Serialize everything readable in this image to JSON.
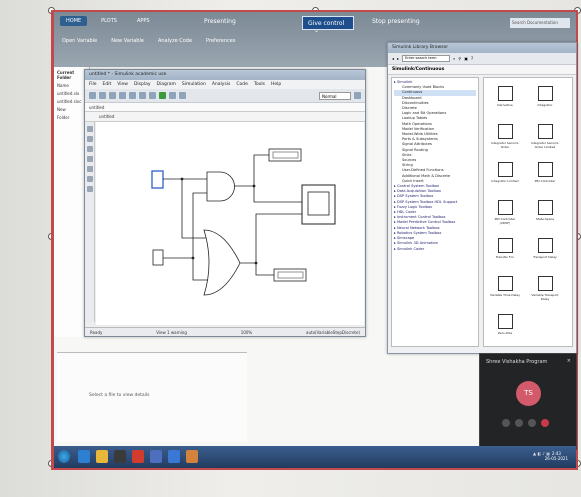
{
  "presentation_bar": {
    "tab_home": "HOME",
    "tab_plots": "PLOTS",
    "tab_apps": "APPS",
    "presenting": "Presenting",
    "give_control": "Give control",
    "stop_presenting": "Stop presenting",
    "search_placeholder": "Search Documentation"
  },
  "matlab_toolbar": {
    "open_variable": "Open Variable",
    "new_variable": "New Variable",
    "analyze_code": "Analyze Code",
    "preferences": "Preferences"
  },
  "left_tree": {
    "header": "Current Folder",
    "items": [
      "Name",
      "untitled.slx",
      "untitled.slxc",
      "New",
      "Folder"
    ]
  },
  "model_window": {
    "title": "untitled * - Simulink academic use",
    "menu": [
      "File",
      "Edit",
      "View",
      "Display",
      "Diagram",
      "Simulation",
      "Analysis",
      "Code",
      "Tools",
      "Help"
    ],
    "sim_mode": "Normal",
    "breadcrumb": "untitled",
    "breadcrumb2": "untitled",
    "status_ready": "Ready",
    "status_warning": "View 1 warning",
    "status_zoom": "100%",
    "status_solver": "auto(VariableStepDiscrete)"
  },
  "library_browser": {
    "title": "Simulink Library Browser",
    "search_placeholder": "Enter search term",
    "heading": "Simulink/Continuous",
    "tree": [
      {
        "label": "Simulink",
        "indent": 0
      },
      {
        "label": "Commonly Used Blocks",
        "indent": 1
      },
      {
        "label": "Continuous",
        "indent": 1
      },
      {
        "label": "Dashboard",
        "indent": 1
      },
      {
        "label": "Discontinuities",
        "indent": 1
      },
      {
        "label": "Discrete",
        "indent": 1
      },
      {
        "label": "Logic and Bit Operations",
        "indent": 1
      },
      {
        "label": "Lookup Tables",
        "indent": 1
      },
      {
        "label": "Math Operations",
        "indent": 1
      },
      {
        "label": "Model Verification",
        "indent": 1
      },
      {
        "label": "Model-Wide Utilities",
        "indent": 1
      },
      {
        "label": "Ports & Subsystems",
        "indent": 1
      },
      {
        "label": "Signal Attributes",
        "indent": 1
      },
      {
        "label": "Signal Routing",
        "indent": 1
      },
      {
        "label": "Sinks",
        "indent": 1
      },
      {
        "label": "Sources",
        "indent": 1
      },
      {
        "label": "String",
        "indent": 1
      },
      {
        "label": "User-Defined Functions",
        "indent": 1
      },
      {
        "label": "Additional Math & Discrete",
        "indent": 1
      },
      {
        "label": "Quick Insert",
        "indent": 1
      },
      {
        "label": "Control System Toolbox",
        "indent": 0
      },
      {
        "label": "Data Acquisition Toolbox",
        "indent": 0
      },
      {
        "label": "DSP System Toolbox",
        "indent": 0
      },
      {
        "label": "DSP System Toolbox HDL Support",
        "indent": 0
      },
      {
        "label": "Fuzzy Logic Toolbox",
        "indent": 0
      },
      {
        "label": "HDL Coder",
        "indent": 0
      },
      {
        "label": "Instrument Control Toolbox",
        "indent": 0
      },
      {
        "label": "Model Predictive Control Toolbox",
        "indent": 0
      },
      {
        "label": "Neural Network Toolbox",
        "indent": 0
      },
      {
        "label": "Robotics System Toolbox",
        "indent": 0
      },
      {
        "label": "Simscape",
        "indent": 0
      },
      {
        "label": "Simulink 3D Animation",
        "indent": 0
      },
      {
        "label": "Simulink Coder",
        "indent": 0
      }
    ],
    "blocks": [
      "Derivative",
      "Integrator",
      "Integrator Second-Order",
      "Integrator Second-Order Limited",
      "Integrator Limited",
      "PID Controller",
      "PID Controller (2DOF)",
      "State-Space",
      "Transfer Fcn",
      "Transport Delay",
      "Variable Time Delay",
      "Variable Transport Delay",
      "Zero-Pole"
    ]
  },
  "details_panel": {
    "message": "Select a file to view details"
  },
  "call": {
    "label": "Shree Vishakha Program",
    "initials": "TS",
    "close": "×"
  },
  "taskbar": {
    "tray": "▲ ◧ ♪ ▦",
    "time": "2:43",
    "date": "26-05-2021"
  }
}
